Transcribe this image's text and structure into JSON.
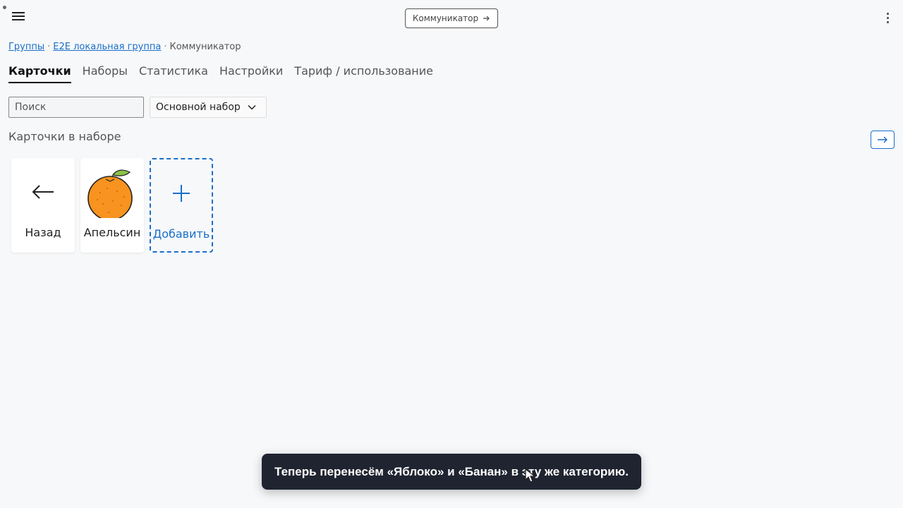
{
  "header": {
    "center_button_label": "Коммуникатор",
    "center_button_icon": "arrow-right-icon",
    "menu_icon": "hamburger-menu-icon",
    "more_icon": "more-vertical-icon"
  },
  "breadcrumb": {
    "items": [
      "Группы",
      "E2E локальная группа",
      "Коммуникатор"
    ],
    "separator": "·"
  },
  "tabs": [
    {
      "label": "Карточки",
      "active": true
    },
    {
      "label": "Наборы",
      "active": false
    },
    {
      "label": "Статистика",
      "active": false
    },
    {
      "label": "Настройки",
      "active": false
    },
    {
      "label": "Тариф / использование",
      "active": false
    }
  ],
  "filters": {
    "search_placeholder": "Поиск",
    "set_select_value": "Основной набор"
  },
  "section": {
    "title": "Карточки в наборе",
    "action_icon": "arrow-right-icon"
  },
  "cards": [
    {
      "label": "Назад",
      "icon": "arrow-left-icon"
    },
    {
      "label": "Апельсин",
      "icon": "orange-image"
    },
    {
      "label": "Добавить",
      "icon": "plus-icon"
    }
  ],
  "toast": {
    "text": "Теперь перенесём «Яблоко» и «Банан» в эту же категорию."
  },
  "colors": {
    "accent": "#1a6fc9",
    "toast_bg": "#1f2430",
    "page_bg": "#f7f8fa"
  }
}
